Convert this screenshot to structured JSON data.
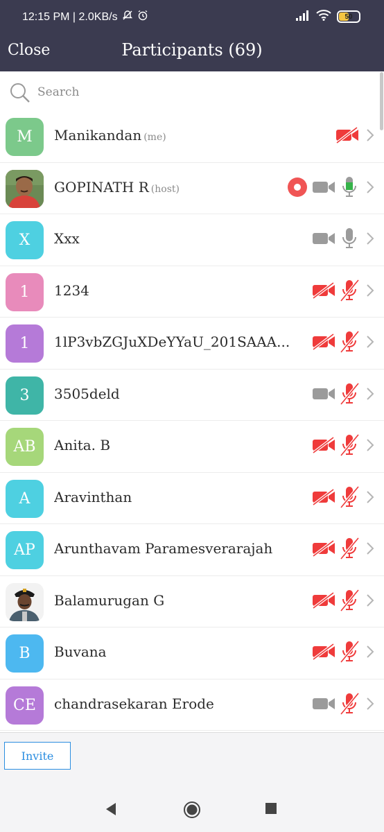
{
  "status_bar": {
    "time_speed": "12:15 PM | 2.0KB/s",
    "battery": "50",
    "battery_fraction": 0.5
  },
  "header": {
    "close_label": "Close",
    "title": "Participants (69)"
  },
  "search": {
    "placeholder": "Search"
  },
  "participants": [
    {
      "name": "Manikandan",
      "tag": "(me)",
      "initials": "M",
      "color": "#7cc98b",
      "photo": false,
      "recording": false,
      "video": "off",
      "mic": "none"
    },
    {
      "name": "GOPINATH R",
      "tag": "(host)",
      "initials": "",
      "color": "#8a5a40",
      "photo": true,
      "recording": true,
      "video": "on",
      "mic": "active"
    },
    {
      "name": "Xxx",
      "tag": "",
      "initials": "X",
      "color": "#4ed0e1",
      "photo": false,
      "recording": false,
      "video": "on",
      "mic": "on"
    },
    {
      "name": "1234",
      "tag": "",
      "initials": "1",
      "color": "#e88bbb",
      "photo": false,
      "recording": false,
      "video": "off",
      "mic": "off"
    },
    {
      "name": "1lP3vbZGJuXDeYYaU_201SAAA...",
      "tag": "",
      "initials": "1",
      "color": "#b57ad8",
      "photo": false,
      "recording": false,
      "video": "off",
      "mic": "off"
    },
    {
      "name": "3505deld",
      "tag": "",
      "initials": "3",
      "color": "#3fb5a7",
      "photo": false,
      "recording": false,
      "video": "on",
      "mic": "off"
    },
    {
      "name": "Anita. B",
      "tag": "",
      "initials": "AB",
      "color": "#a6d77a",
      "photo": false,
      "recording": false,
      "video": "off",
      "mic": "off"
    },
    {
      "name": "Aravinthan",
      "tag": "",
      "initials": "A",
      "color": "#4ed0e1",
      "photo": false,
      "recording": false,
      "video": "off",
      "mic": "off"
    },
    {
      "name": "Arunthavam Paramesverarajah",
      "tag": "",
      "initials": "AP",
      "color": "#4ed0e1",
      "photo": false,
      "recording": false,
      "video": "off",
      "mic": "off"
    },
    {
      "name": "Balamurugan G",
      "tag": "",
      "initials": "",
      "color": "#ffffff",
      "photo": true,
      "recording": false,
      "video": "off",
      "mic": "off"
    },
    {
      "name": "Buvana",
      "tag": "",
      "initials": "B",
      "color": "#4db8f0",
      "photo": false,
      "recording": false,
      "video": "off",
      "mic": "off"
    },
    {
      "name": "chandrasekaran Erode",
      "tag": "",
      "initials": "CE",
      "color": "#b57ad8",
      "photo": false,
      "recording": false,
      "video": "on",
      "mic": "off"
    }
  ],
  "footer": {
    "invite_label": "Invite"
  }
}
